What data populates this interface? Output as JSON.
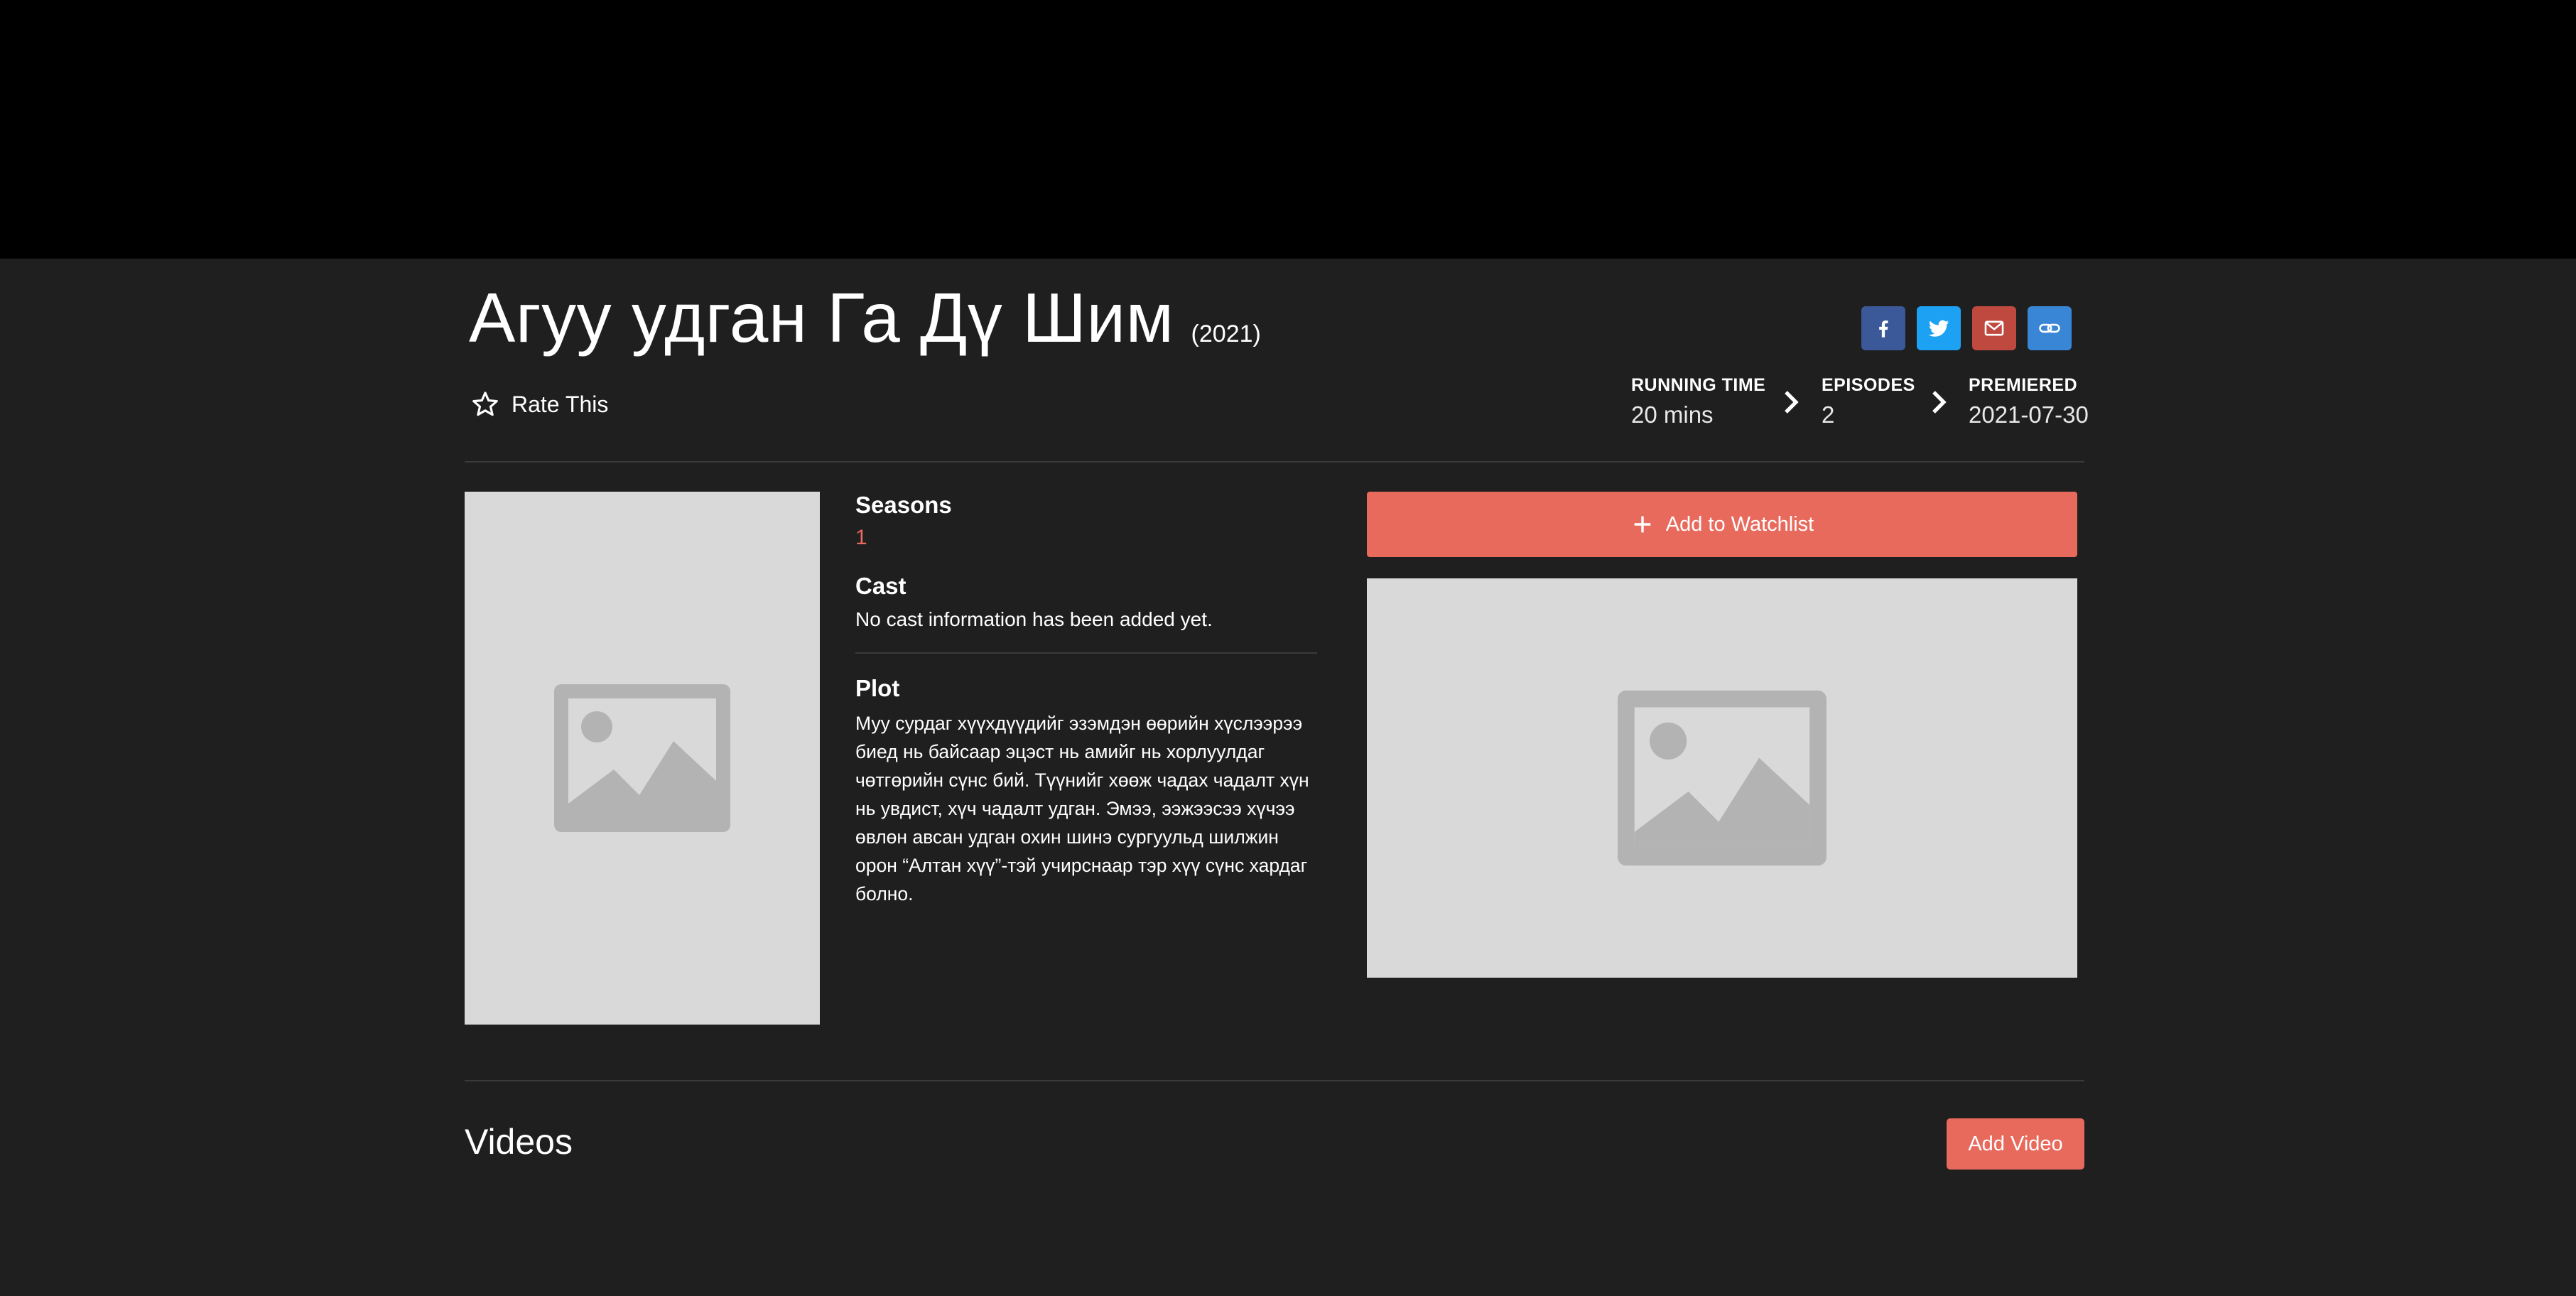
{
  "show": {
    "title": "Агуу удган Га Дү Шим",
    "year": "(2021)",
    "rate_label": "Rate This"
  },
  "share": {
    "icons": [
      "facebook-icon",
      "twitter-icon",
      "email-icon",
      "link-icon"
    ],
    "colors": [
      "#3b5998",
      "#1da1f2",
      "#c0493f",
      "#3a86d6"
    ]
  },
  "stats": {
    "running_time_label": "RUNNING TIME",
    "running_time_value": "20 mins",
    "episodes_label": "EPISODES",
    "episodes_value": "2",
    "premiered_label": "PREMIERED",
    "premiered_value": "2021-07-30"
  },
  "details": {
    "seasons_label": "Seasons",
    "seasons_value": "1",
    "cast_label": "Cast",
    "cast_value": "No cast information has been added yet.",
    "plot_label": "Plot",
    "plot_value": "Муу сурдаг хүүхдүүдийг эзэмдэн өөрийн хүслээрээ биед нь байсаар эцэст нь амийг нь хорлуулдаг чөтгөрийн сүнс бий. Түүнийг хөөж чадах чадалт хүн нь увдист, хүч чадалт удган. Эмээ, ээжээсээ хүчээ өвлөн авсан удган охин шинэ сургуульд шилжин орон “Алтан хүү”-тэй учирснаар тэр хүү сүнс хардаг болно."
  },
  "actions": {
    "watchlist_label": "Add to Watchlist",
    "add_video_label": "Add Video"
  },
  "videos": {
    "heading": "Videos"
  },
  "colors": {
    "accent": "#e86a5d",
    "background": "#1f1f1f",
    "header": "#000000",
    "placeholder": "#d9d9d9"
  }
}
